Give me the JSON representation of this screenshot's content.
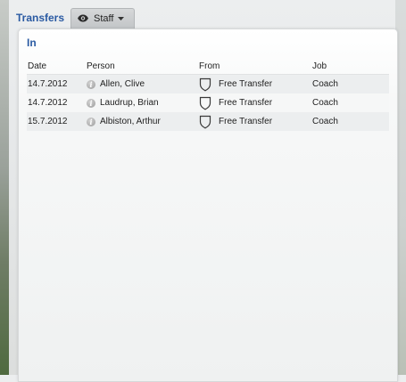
{
  "header": {
    "title": "Transfers",
    "staff_label": "Staff"
  },
  "section": {
    "title": "In"
  },
  "columns": {
    "date": "Date",
    "person": "Person",
    "from": "From",
    "job": "Job"
  },
  "rows": [
    {
      "date": "14.7.2012",
      "person": "Allen, Clive",
      "from": "Free Transfer",
      "job": "Coach"
    },
    {
      "date": "14.7.2012",
      "person": "Laudrup, Brian",
      "from": "Free Transfer",
      "job": "Coach"
    },
    {
      "date": "15.7.2012",
      "person": "Albiston, Arthur",
      "from": "Free Transfer",
      "job": "Coach"
    }
  ],
  "icons": {
    "view": "eye-icon",
    "dropdown": "caret-down-icon",
    "info": "info-icon",
    "club": "shield-crest-icon"
  },
  "colors": {
    "accent": "#2a5aa2",
    "row_alt": "#eceeef"
  }
}
